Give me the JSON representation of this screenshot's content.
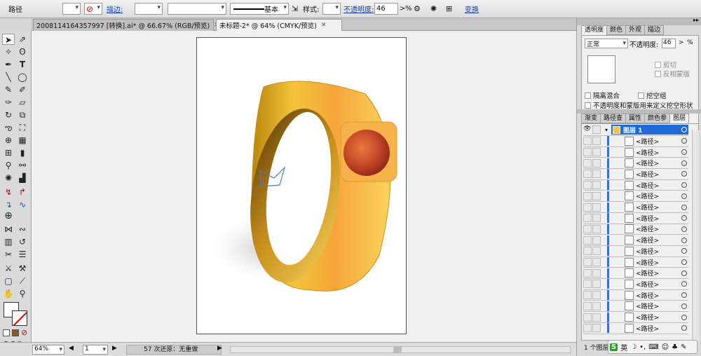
{
  "control_bar": {
    "object_type": "路径",
    "stroke_label": "描边:",
    "stroke_style": "基本",
    "style_label": "样式:",
    "opacity_label": "不透明度:",
    "opacity_value": "46",
    "opacity_unit": "%",
    "transform_link": "变换"
  },
  "tabs": [
    {
      "label": "2008114164357997 [转换].ai* @ 66.67% (RGB/预览)",
      "active": false
    },
    {
      "label": "未标题-2* @ 64% (CMYK/预览)",
      "active": true
    }
  ],
  "transparency_panel": {
    "tabs": [
      "透明度",
      "颜色",
      "外观",
      "描边"
    ],
    "blend_mode": "正常",
    "opacity_label": "不透明度:",
    "opacity_value": "46",
    "clip_label": "剪切",
    "invert_mask_label": "反相蒙版",
    "isolate_label": "隔离混合",
    "knockout_label": "挖空组",
    "opacity_mask_label": "不透明度和蒙版用来定义挖空形状"
  },
  "layers_panel": {
    "tabs": [
      "渐变",
      "路径查",
      "属性",
      "颜色参",
      "图层"
    ],
    "layer_name": "图层 1",
    "sublayer_label": "<路径>",
    "footer_count": "1 个图层"
  },
  "status_bar": {
    "zoom": "64%",
    "artboard": "1",
    "undo_info": "57 次还原：无重做"
  },
  "ime": {
    "lang": "英"
  }
}
